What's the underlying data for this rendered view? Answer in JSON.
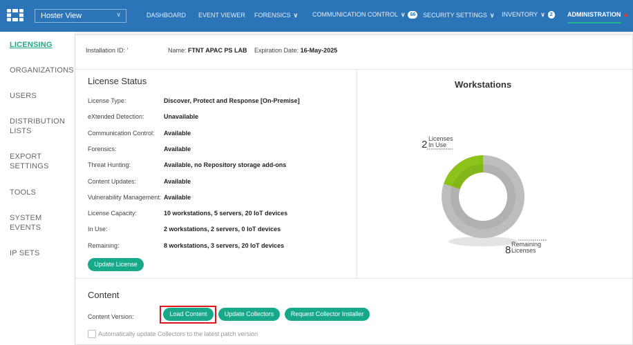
{
  "header": {
    "view_select": "Hoster View",
    "nav": [
      {
        "label": "DASHBOARD"
      },
      {
        "label": "EVENT VIEWER"
      },
      {
        "label": "FORENSICS"
      },
      {
        "label": "COMMUNICATION CONTROL",
        "badge": "66"
      },
      {
        "label": "SECURITY SETTINGS"
      },
      {
        "label": "INVENTORY",
        "badge": "2"
      },
      {
        "label": "ADMINISTRATION"
      }
    ]
  },
  "sidebar": [
    "LICENSING",
    "ORGANIZATIONS",
    "USERS",
    "DISTRIBUTION LISTS",
    "EXPORT SETTINGS",
    "TOOLS",
    "SYSTEM EVENTS",
    "IP SETS"
  ],
  "info": {
    "install_label": "Installation ID:",
    "install_value": "'",
    "name_label": "Name:",
    "name_value": "FTNT APAC PS LAB",
    "exp_label": "Expiration Date:",
    "exp_value": "16-May-2025"
  },
  "license": {
    "title": "License Status",
    "rows": [
      {
        "label": "License Type:",
        "value": "Discover, Protect and Response [On-Premise]"
      },
      {
        "label": "eXtended Detection:",
        "value": "Unavailable"
      },
      {
        "label": "Communication Control:",
        "value": "Available"
      },
      {
        "label": "Forensics:",
        "value": "Available"
      },
      {
        "label": "Threat Hunting:",
        "value": "Available, no Repository storage add-ons"
      },
      {
        "label": "Content Updates:",
        "value": "Available"
      },
      {
        "label": "Vulnerability Management:",
        "value": "Available"
      },
      {
        "label": "License Capacity:",
        "value": "10 workstations, 5 servers, 20 IoT devices"
      },
      {
        "label": "In Use:",
        "value": "2 workstations, 2 servers, 0 IoT devices"
      },
      {
        "label": "Remaining:",
        "value": "8 workstations, 3 servers, 20 IoT devices"
      }
    ],
    "update_button": "Update License"
  },
  "chart_data": {
    "type": "pie",
    "title": "Workstations",
    "series": [
      {
        "name": "Licenses In Use",
        "value": 2,
        "color": "#8cc21a"
      },
      {
        "name": "Remaining Licenses",
        "value": 8,
        "color": "#bdbdbd"
      }
    ],
    "labels": {
      "in_use_num": "2",
      "in_use_l1": "Licenses",
      "in_use_l2": "In Use",
      "rem_num": "8",
      "rem_l1": "Remaining",
      "rem_l2": "Licenses"
    }
  },
  "content": {
    "title": "Content",
    "version_label": "Content Version:",
    "buttons": [
      "Load Content",
      "Update Collectors",
      "Request Collector Installer"
    ],
    "auto_update_label": "Automatically update Collectors to the latest patch version",
    "auto_update_checked": false
  }
}
